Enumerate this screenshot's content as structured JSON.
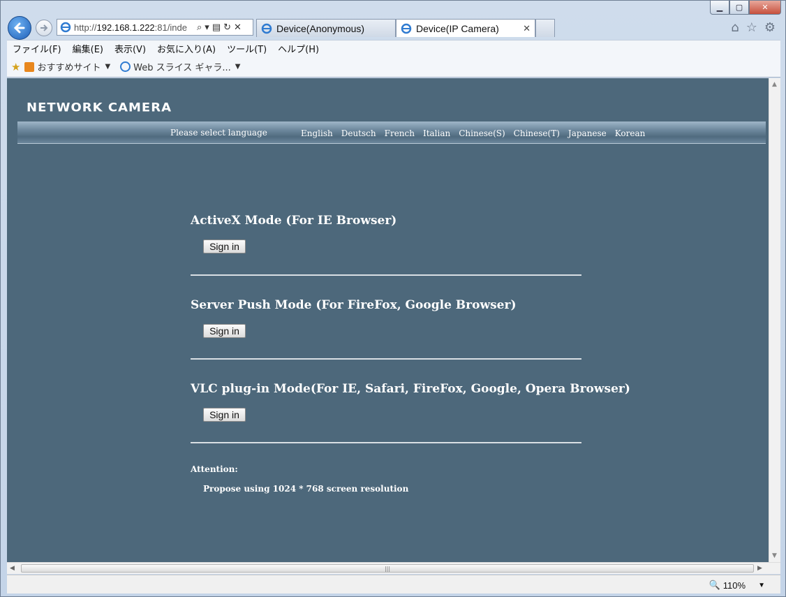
{
  "browser": {
    "url_prefix": "http://",
    "url_host": "192.168.1.222",
    "url_rest": ":81/inde",
    "tabs": [
      {
        "label": "Device(Anonymous)"
      },
      {
        "label": "Device(IP Camera)"
      }
    ],
    "menu": [
      "ファイル(F)",
      "編集(E)",
      "表示(V)",
      "お気に入り(A)",
      "ツール(T)",
      "ヘルプ(H)"
    ],
    "favorites": [
      {
        "label": "おすすめサイト"
      },
      {
        "label": "Web スライス ギャラ..."
      }
    ],
    "zoom": "110%"
  },
  "page": {
    "logo": "NETWORK CAMERA",
    "language_prompt": "Please select language",
    "languages": [
      "English",
      "Deutsch",
      "French",
      "Italian",
      "Chinese(S)",
      "Chinese(T)",
      "Japanese",
      "Korean"
    ],
    "modes": [
      {
        "title": "ActiveX Mode (For IE Browser)",
        "button": "Sign in"
      },
      {
        "title": "Server Push Mode (For FireFox, Google Browser)",
        "button": "Sign in"
      },
      {
        "title": "VLC plug-in Mode(For IE, Safari, FireFox, Google, Opera Browser)",
        "button": "Sign in"
      }
    ],
    "attention_label": "Attention:",
    "attention_note": "Propose using 1024 * 768 screen resolution"
  }
}
